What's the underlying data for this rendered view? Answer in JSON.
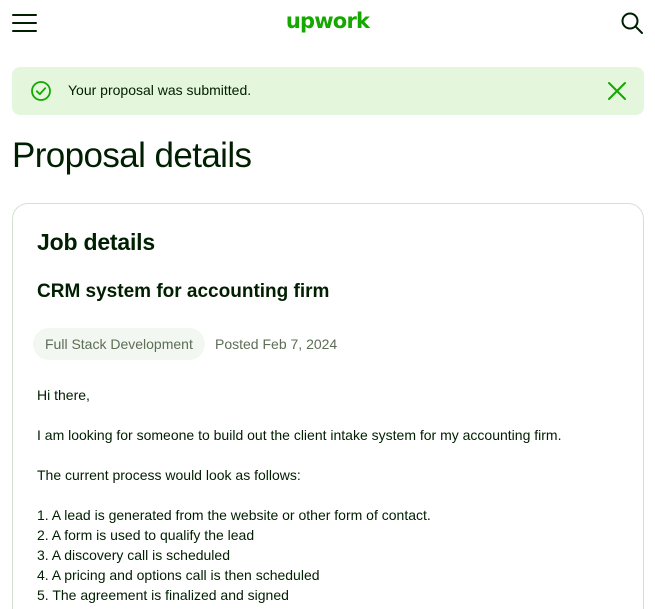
{
  "header": {
    "logo_text": "upwork",
    "menu_icon": "hamburger-menu-icon",
    "search_icon": "search-icon"
  },
  "alert": {
    "message": "Your proposal was submitted.",
    "status_icon": "check-circle-icon",
    "close_icon": "close-icon",
    "background_color": "#e4f6dc",
    "accent_color": "#14a800"
  },
  "page": {
    "title": "Proposal details"
  },
  "job": {
    "section_title": "Job details",
    "title": "CRM system for accounting firm",
    "category": "Full Stack Development",
    "posted_label": "Posted",
    "posted_date": "Feb 7, 2024",
    "description": [
      "Hi there,",
      "",
      "I am looking for someone to build out the client intake system for my accounting firm.",
      "",
      "The current process would look as follows:",
      "",
      "1. A lead is generated from the website or other form of contact.",
      "2. A form is used to qualify the lead",
      "3. A discovery call is scheduled",
      "4. A pricing and options call is then scheduled",
      "5. The agreement is finalized and signed"
    ]
  },
  "colors": {
    "brand": "#14a800",
    "text": "#001e00",
    "muted": "#5e6d55",
    "border": "#d5e0d5"
  }
}
